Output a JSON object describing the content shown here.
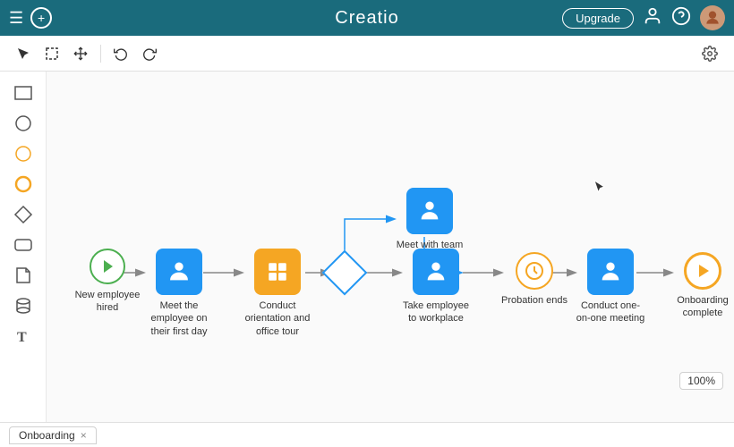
{
  "header": {
    "title": "Creatio",
    "upgrade_label": "Upgrade",
    "hamburger": "☰",
    "add": "+",
    "user_icon": "👤",
    "help_icon": "?",
    "settings_icon": "⚙"
  },
  "toolbar": {
    "select_icon": "▶",
    "area_select_icon": "⬚",
    "move_icon": "✥",
    "undo_icon": "↩",
    "redo_icon": "↪",
    "settings_icon": "⚙"
  },
  "shapes": [
    {
      "name": "rectangle",
      "label": "Rectangle"
    },
    {
      "name": "circle",
      "label": "Circle"
    },
    {
      "name": "circle-outline",
      "label": "Circle outline"
    },
    {
      "name": "circle-outline2",
      "label": "Circle outline 2"
    },
    {
      "name": "diamond",
      "label": "Diamond"
    },
    {
      "name": "rounded-rect",
      "label": "Rounded rect"
    },
    {
      "name": "document",
      "label": "Document"
    },
    {
      "name": "cylinder",
      "label": "Cylinder"
    },
    {
      "name": "text",
      "label": "Text"
    }
  ],
  "nodes": [
    {
      "id": "start",
      "label": "New employee hired",
      "type": "start"
    },
    {
      "id": "task1",
      "label": "Meet the employee on their first day",
      "type": "blue"
    },
    {
      "id": "task2",
      "label": "Conduct orientation and office tour",
      "type": "orange"
    },
    {
      "id": "gateway",
      "label": "",
      "type": "gateway"
    },
    {
      "id": "task_upper",
      "label": "Meet with team lead",
      "type": "blue"
    },
    {
      "id": "task3",
      "label": "Take employee to workplace",
      "type": "blue"
    },
    {
      "id": "timer",
      "label": "Probation ends",
      "type": "timer"
    },
    {
      "id": "task4",
      "label": "Conduct one-on-one meeting",
      "type": "blue"
    },
    {
      "id": "end",
      "label": "Onboarding complete",
      "type": "end"
    }
  ],
  "zoom": "100%",
  "tab": {
    "label": "Onboarding",
    "close": "×"
  }
}
